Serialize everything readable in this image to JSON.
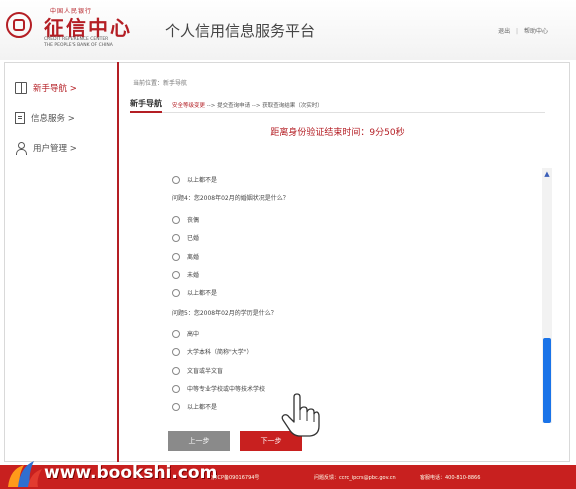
{
  "header": {
    "logo_top": "中国人民银行",
    "logo_title": "征信中心",
    "logo_en1": "CREDIT REFERENCE CENTER",
    "logo_en2": "THE PEOPLE'S BANK OF CHINA",
    "platform_title": "个人信用信息服务平台",
    "logout": "退出",
    "help": "帮助中心",
    "separator": "|"
  },
  "sidebar": {
    "items": [
      {
        "label": "新手导航 >",
        "icon": "book-icon",
        "active": true
      },
      {
        "label": "信息服务 >",
        "icon": "document-icon",
        "active": false
      },
      {
        "label": "用户管理 >",
        "icon": "user-icon",
        "active": false
      }
    ]
  },
  "breadcrumb": "当前位置：新手导航",
  "steps": {
    "title": "新手导航",
    "step1": "安全等级变更",
    "arrow1": " --> ",
    "step2": "提交查询申请",
    "arrow2": " --> ",
    "step3": "获取查询结果（次实时）"
  },
  "timer": "距离身份验证结束时间：9分50秒",
  "questions": {
    "prev_last_option": "以上都不是",
    "q4": {
      "text": "问题4：您2008年02月的婚姻状况是什么？",
      "options": [
        "丧偶",
        "已婚",
        "离婚",
        "未婚",
        "以上都不是"
      ]
    },
    "q5": {
      "text": "问题5：您2008年02月的学历是什么？",
      "options": [
        "高中",
        "大学本科（简称\"大学\"）",
        "文盲或半文盲",
        "中等专业学校或中等技术学校",
        "以上都不是"
      ]
    }
  },
  "buttons": {
    "prev": "上一步",
    "next": "下一步"
  },
  "footer": {
    "watermark": "www.bookshi.com",
    "icp": "京ICP备09016794号",
    "feedback": "问题反馈：ccrc_ipcrs@pbc.gov.cn",
    "hotline": "客服电话：400-810-8866"
  },
  "colors": {
    "brand_red": "#b41e24",
    "footer_red": "#c8201f",
    "scroll_blue": "#1a73e8"
  }
}
